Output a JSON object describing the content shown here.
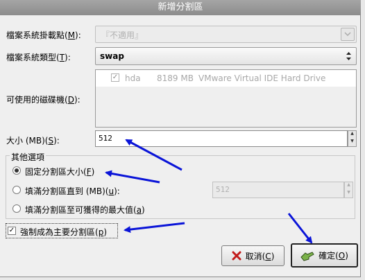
{
  "window": {
    "title": "新增分割區"
  },
  "mount_point": {
    "label_pre": "檔案系統掛載點(",
    "mnemonic": "M",
    "label_post": "):",
    "value": "『不適用』"
  },
  "fs_type": {
    "label_pre": "檔案系統類型(",
    "mnemonic": "T",
    "label_post": "):",
    "value": "swap"
  },
  "drives": {
    "label_pre": "可使用的磁碟機(",
    "mnemonic": "D",
    "label_post": "):",
    "rows": [
      {
        "checked": true,
        "name": "hda",
        "size": "8189 MB",
        "model": "VMware Virtual IDE Hard Drive"
      }
    ]
  },
  "size": {
    "label_pre": "大小 (MB)(",
    "mnemonic": "S",
    "label_post": "):",
    "value": "512"
  },
  "other_options": {
    "title": "其他選項",
    "fixed": {
      "label_pre": "固定分割區大小(",
      "mnemonic": "F",
      "label_post": ")",
      "selected": true
    },
    "fill_to": {
      "label_pre": "填滿分割區直到 (MB)(",
      "mnemonic": "u",
      "label_post": "):",
      "value": "512"
    },
    "fill_max": {
      "label_pre": "填滿分割區至可獲得的最大值(",
      "mnemonic": "a",
      "label_post": ")"
    }
  },
  "force_primary": {
    "label_pre": "強制成為主要分割區(",
    "mnemonic": "p",
    "label_post": ")",
    "checked": true
  },
  "buttons": {
    "cancel": {
      "label_pre": "取消(",
      "mnemonic": "C",
      "label_post": ")",
      "icon": "cancel-x-icon"
    },
    "ok": {
      "label_pre": "確定(",
      "mnemonic": "O",
      "label_post": ")",
      "icon": "ok-hand-icon"
    }
  },
  "annotation": {
    "arrow_color": "#0a14d8"
  }
}
